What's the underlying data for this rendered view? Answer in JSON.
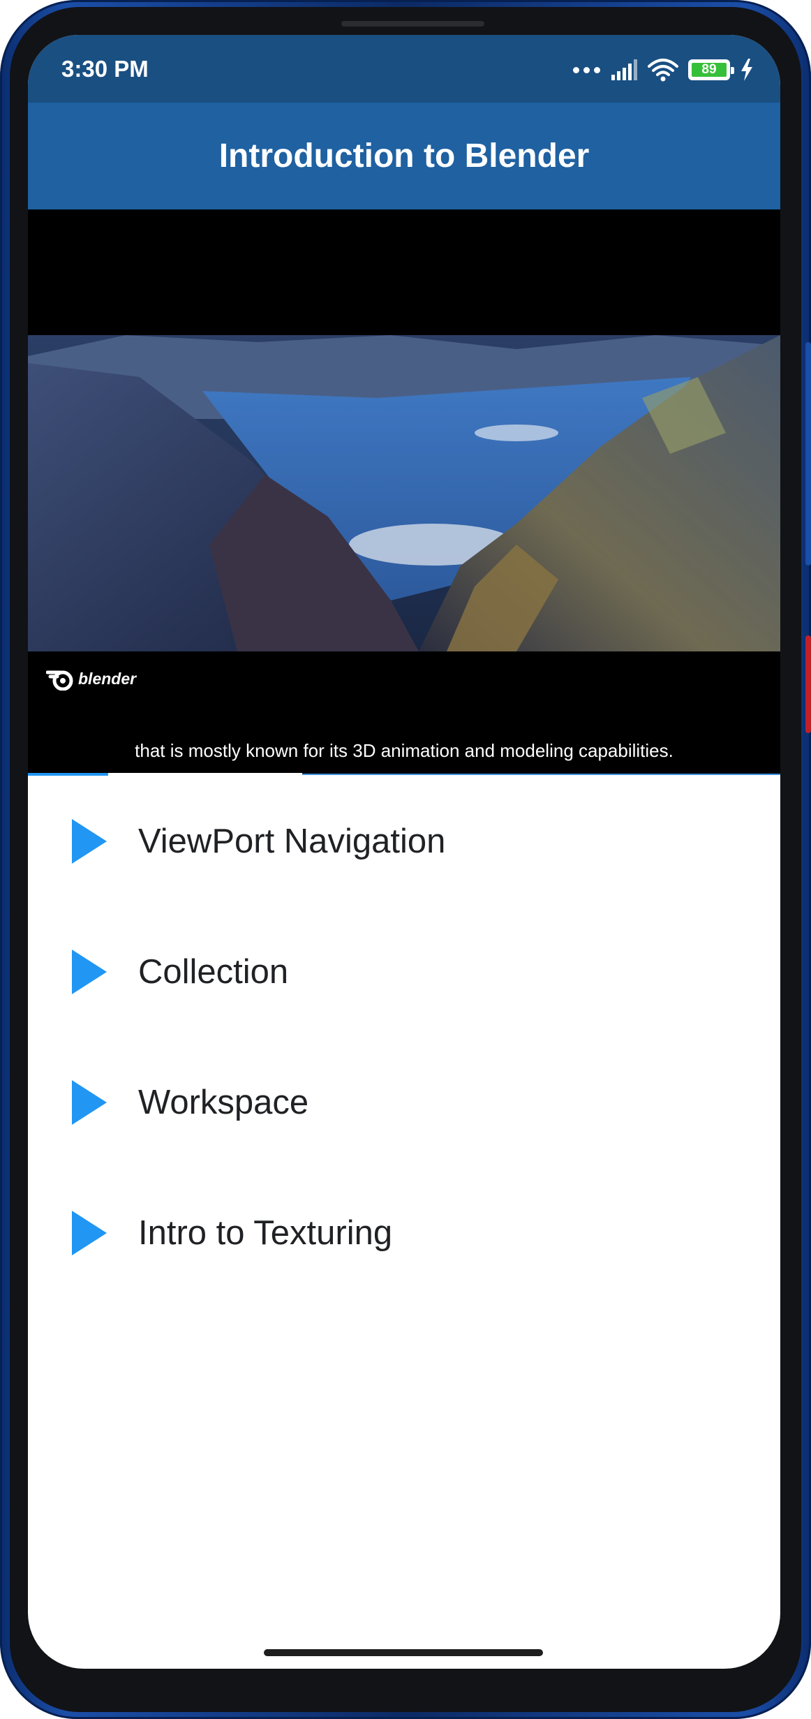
{
  "status_bar": {
    "time": "3:30 PM",
    "battery_level": "89",
    "icons": [
      "more-dots-icon",
      "signal-icon",
      "wifi-icon",
      "battery-icon",
      "charging-icon"
    ]
  },
  "app_bar": {
    "title": "Introduction to Blender"
  },
  "video": {
    "watermark": "blender",
    "caption": "that is mostly known for its 3D animation and modeling capabilities.",
    "progress_played": 0.107,
    "progress_buffered": 0.365
  },
  "lessons": [
    {
      "label": "ViewPort Navigation",
      "icon": "play-icon"
    },
    {
      "label": "Collection",
      "icon": "play-icon"
    },
    {
      "label": "Workspace",
      "icon": "play-icon"
    },
    {
      "label": "Intro to Texturing",
      "icon": "play-icon"
    }
  ],
  "colors": {
    "status_bar": "#1a4f82",
    "app_bar": "#1f61a1",
    "accent": "#2196f3",
    "text": "#202124"
  }
}
